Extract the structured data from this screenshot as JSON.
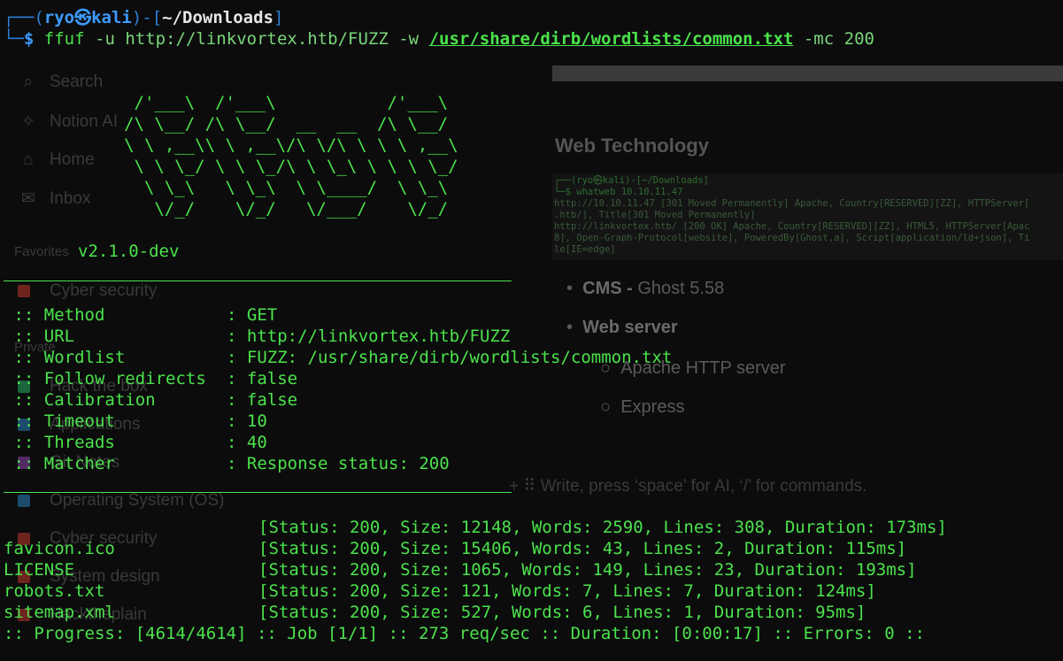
{
  "background": {
    "sidebar": {
      "items": [
        {
          "icon": "search-icon",
          "glyph": "⌕",
          "label": "Search"
        },
        {
          "icon": "notion-ai-icon",
          "glyph": "✧",
          "label": "Notion AI"
        },
        {
          "icon": "home-icon",
          "glyph": "⌂",
          "label": "Home"
        },
        {
          "icon": "inbox-icon",
          "glyph": "✉",
          "label": "Inbox"
        }
      ],
      "favorites_label": "Favorites",
      "private_label": "Private",
      "pages": [
        {
          "color": "#c0392b",
          "label": "Cyber security"
        },
        {
          "color": "#27ae60",
          "label": "Hack the box"
        },
        {
          "color": "#2980b9",
          "label": "Applications"
        },
        {
          "color": "#8e44ad",
          "label": "Git Notes"
        },
        {
          "color": "#2980b9",
          "label": "Operating System (OS)"
        },
        {
          "color": "#c0392b",
          "label": "Cyber security"
        },
        {
          "color": "#c0392b",
          "label": "System design"
        },
        {
          "color": "#c0392b",
          "label": "Hacktheplain"
        }
      ]
    },
    "main": {
      "heading": "Web Technology",
      "mini_terminal": [
        "┌──(ryo㉿kali)-[~/Downloads]",
        "└─$ whatweb 10.10.11.47",
        "http://10.10.11.47 [301 Moved Permanently] Apache, Country[RESERVED][ZZ], HTTPServer[",
        ".htb/], Title[301 Moved Permanently]",
        "http://linkvortex.htb/ [200 OK] Apache, Country[RESERVED][ZZ], HTML5, HTTPServer[Apac",
        "8], Open-Graph-Protocol[website], PoweredBy[Ghost,a], Script[application/ld+json], Ti",
        "le[IE=edge]"
      ],
      "bullets": [
        {
          "level": 1,
          "bold": "CMS -",
          "text": " Ghost 5.58"
        },
        {
          "level": 1,
          "bold": "Web server",
          "text": ""
        },
        {
          "level": 2,
          "bold": "",
          "text": "Apache HTTP server"
        },
        {
          "level": 2,
          "bold": "",
          "text": "Express"
        }
      ],
      "hint": "+ ⠿ Write, press ‘space’ for AI, ‘/’ for commands."
    }
  },
  "terminal": {
    "prompt": {
      "top_left": "┌──(",
      "user": "ryo㉿kali",
      "mid": ")-[",
      "path": "~/Downloads",
      "end": "]",
      "corner": "└─",
      "dollar": "$"
    },
    "command": {
      "binary": "ffuf",
      "flag_u": "-u",
      "url": "http://linkvortex.htb/FUZZ",
      "flag_w": "-w",
      "wordlist": "/usr/share/dirb/wordlists/common.txt",
      "flag_mc": "-mc",
      "mc_value": "200"
    },
    "banner": [
      "        /'___\\  /'___\\           /'___\\",
      "       /\\ \\__/ /\\ \\__/  __  __  /\\ \\__/",
      "       \\ \\ ,__\\\\ \\ ,__\\/\\ \\/\\ \\ \\ \\ ,__\\",
      "        \\ \\ \\_/ \\ \\ \\_/\\ \\ \\_\\ \\ \\ \\ \\_/",
      "         \\ \\_\\   \\ \\_\\  \\ \\____/  \\ \\_\\",
      "          \\/_/    \\/_/   \\/___/    \\/_/"
    ],
    "version": "v2.1.0-dev",
    "config": [
      {
        "key": " :: Method           ",
        "value": ": GET"
      },
      {
        "key": " :: URL              ",
        "value": ": http://linkvortex.htb/FUZZ"
      },
      {
        "key": " :: Wordlist         ",
        "value": ": FUZZ: /usr/share/dirb/wordlists/common.txt"
      },
      {
        "key": " :: Follow redirects ",
        "value": ": false"
      },
      {
        "key": " :: Calibration      ",
        "value": ": false"
      },
      {
        "key": " :: Timeout          ",
        "value": ": 10"
      },
      {
        "key": " :: Threads          ",
        "value": ": 40"
      },
      {
        "key": " :: Matcher          ",
        "value": ": Response status: 200"
      }
    ],
    "results": [
      {
        "name": "",
        "status": "[Status: 200, Size: 12148, Words: 2590, Lines: 308, Duration: 173ms]"
      },
      {
        "name": "favicon.ico",
        "status": "[Status: 200, Size: 15406, Words: 43, Lines: 2, Duration: 115ms]"
      },
      {
        "name": "LICENSE",
        "status": "[Status: 200, Size: 1065, Words: 149, Lines: 23, Duration: 193ms]"
      },
      {
        "name": "robots.txt",
        "status": "[Status: 200, Size: 121, Words: 7, Lines: 7, Duration: 124ms]"
      },
      {
        "name": "sitemap.xml",
        "status": "[Status: 200, Size: 527, Words: 6, Lines: 1, Duration: 95ms]"
      }
    ],
    "progress": ":: Progress: [4614/4614] :: Job [1/1] :: 273 req/sec :: Duration: [0:00:17] :: Errors: 0 ::"
  }
}
